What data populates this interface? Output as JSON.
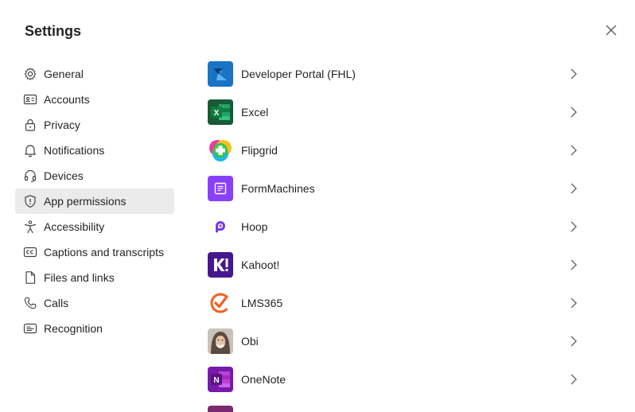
{
  "window": {
    "title": "Settings"
  },
  "sidebar": {
    "items": [
      {
        "label": "General",
        "icon": "gear-icon"
      },
      {
        "label": "Accounts",
        "icon": "id-card-icon"
      },
      {
        "label": "Privacy",
        "icon": "lock-icon"
      },
      {
        "label": "Notifications",
        "icon": "bell-icon"
      },
      {
        "label": "Devices",
        "icon": "headset-icon"
      },
      {
        "label": "App permissions",
        "icon": "shield-icon",
        "active": true
      },
      {
        "label": "Accessibility",
        "icon": "accessibility-icon"
      },
      {
        "label": "Captions and transcripts",
        "icon": "cc-icon"
      },
      {
        "label": "Files and links",
        "icon": "file-icon"
      },
      {
        "label": "Calls",
        "icon": "phone-icon"
      },
      {
        "label": "Recognition",
        "icon": "recognition-icon"
      }
    ]
  },
  "apps": [
    {
      "name": "Developer Portal (FHL)",
      "icon": "developer-portal-icon",
      "color": "#1a73c4"
    },
    {
      "name": "Excel",
      "icon": "excel-icon",
      "color": "#1e6e42"
    },
    {
      "name": "Flipgrid",
      "icon": "flipgrid-icon",
      "color": "#38c548"
    },
    {
      "name": "FormMachines",
      "icon": "formmachines-icon",
      "color": "#8a3ffc"
    },
    {
      "name": "Hoop",
      "icon": "hoop-icon",
      "color": "#6b3cf0"
    },
    {
      "name": "Kahoot!",
      "icon": "kahoot-icon",
      "color": "#46178f"
    },
    {
      "name": "LMS365",
      "icon": "lms365-icon",
      "color": "#f2611d"
    },
    {
      "name": "Obi",
      "icon": "obi-icon",
      "color": "#a08a7a"
    },
    {
      "name": "OneNote",
      "icon": "onenote-icon",
      "color": "#7719aa"
    }
  ],
  "colors": {
    "active_bg": "#ebebeb",
    "text": "#242424",
    "chevron": "#616161"
  }
}
